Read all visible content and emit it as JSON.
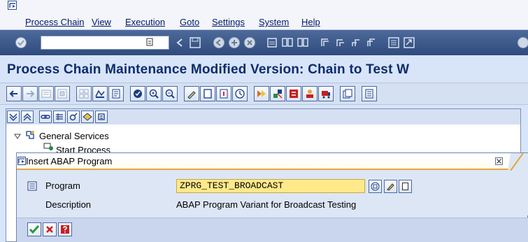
{
  "menubar": {
    "items": [
      {
        "label": "Process Chain"
      },
      {
        "label": "View"
      },
      {
        "label": "Execution"
      },
      {
        "label": "Goto"
      },
      {
        "label": "Settings"
      },
      {
        "label": "System"
      },
      {
        "label": "Help"
      }
    ]
  },
  "system_toolbar": {
    "command_field_value": "",
    "icons": [
      "enter-icon",
      "command-field-dropdown-icon",
      "back-arrow-icon",
      "save-icon",
      "back-icon",
      "exit-icon",
      "cancel-icon",
      "print-icon",
      "find-icon",
      "find-next-icon",
      "first-page-icon",
      "previous-page-icon",
      "next-page-icon",
      "last-page-icon",
      "create-session-icon",
      "shortcut-icon",
      "help-icon"
    ]
  },
  "title": "Process Chain Maintenance Modified Version: Chain to Test W",
  "app_toolbar": {
    "icons": [
      "back-icon",
      "forward-icon",
      "display-icon",
      "change-icon",
      "overview-icon",
      "transport-icon",
      "documentation-icon",
      "check-icon",
      "zoom-in-icon",
      "zoom-out-icon",
      "edit-icon",
      "new-icon",
      "info-icon",
      "schedule-icon",
      "activate-icon",
      "attributes-icon",
      "debug-icon",
      "users-icon",
      "transport-request-icon",
      "layout-icon",
      "log-icon"
    ]
  },
  "tree_toolbar": {
    "icons": [
      "expand-all-icon",
      "collapse-all-icon",
      "link-icon",
      "filter-icon",
      "settings-icon",
      "variant-icon",
      "document-icon"
    ]
  },
  "tree": {
    "node_general_services": "General Services",
    "node_start_process": "Start Process"
  },
  "dialog": {
    "title": "Insert ABAP Program",
    "program_label": "Program",
    "program_value": "ZPRG_TEST_BROADCAST",
    "description_label": "Description",
    "description_value": "ABAP Program Variant for Broadcast Testing",
    "colors": {
      "input_bg": "#ffe98a",
      "title_underline": "#e8a53b"
    }
  },
  "colors": {
    "system_toolbar": "#3d5a8b",
    "title": "#0e2c6b",
    "background": "#d8e4f8"
  }
}
